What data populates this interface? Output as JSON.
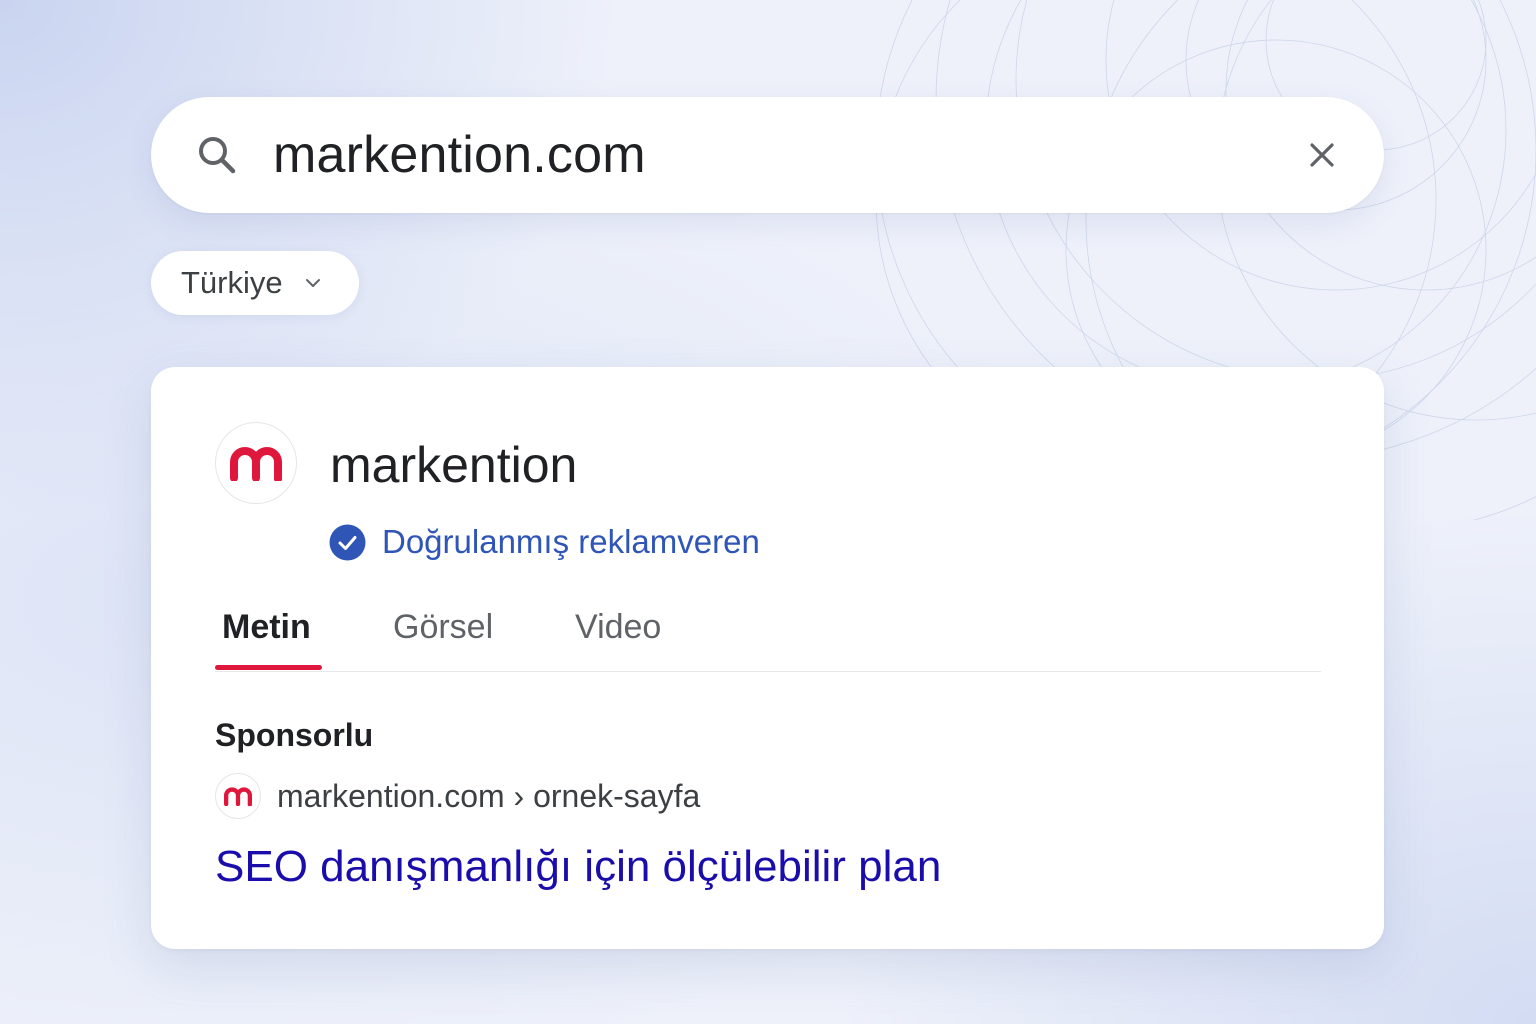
{
  "search": {
    "query": "markention.com",
    "search_icon": "search-icon",
    "clear_icon": "close-icon"
  },
  "region_filter": {
    "label": "Türkiye",
    "icon": "chevron-down-icon"
  },
  "advertiser": {
    "name": "markention",
    "logo": "markention-logo",
    "verified_label": "Doğrulanmış reklamveren",
    "verified_icon": "check-badge-icon"
  },
  "tabs": [
    {
      "label": "Metin",
      "active": true
    },
    {
      "label": "Görsel",
      "active": false
    },
    {
      "label": "Video",
      "active": false
    }
  ],
  "ad": {
    "sponsored_label": "Sponsorlu",
    "display_url": "markention.com › ornek-sayfa",
    "title": "SEO danışmanlığı için ölçülebilir plan"
  },
  "colors": {
    "brand": "#e0173d",
    "verified_blue": "#2f55b7",
    "link_blue": "#1a0dab"
  }
}
